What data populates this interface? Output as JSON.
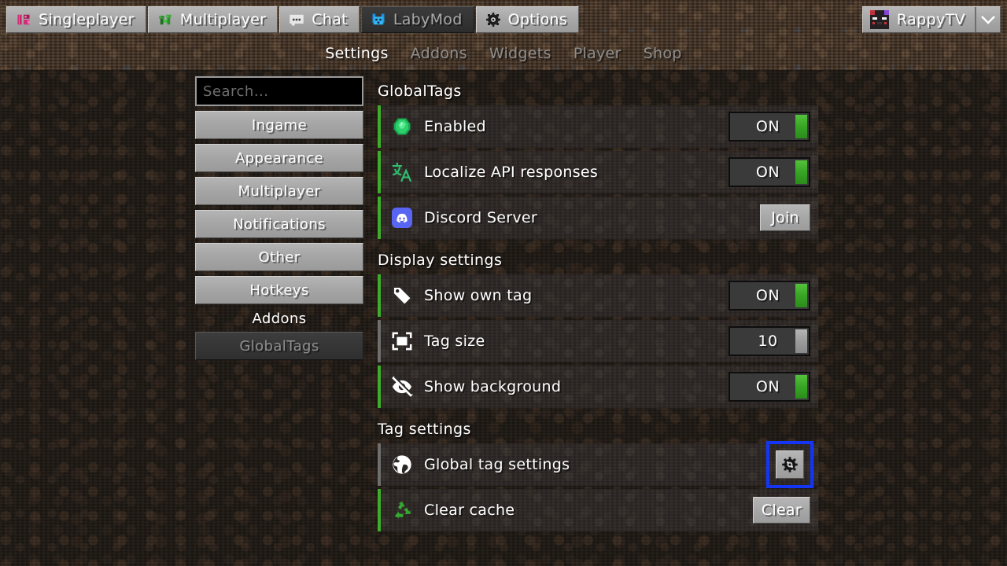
{
  "theme": {
    "accent_green": "#3fad2a",
    "accent_gray": "#6f6f6f",
    "focus_blue": "#1535f5",
    "discord_blurple": "#5865F2",
    "background_dirt": "#1d1712",
    "header_dirt": "#3e2d1f",
    "row_background": "#2c2724",
    "text_white": "#ffffff",
    "text_muted": "#8d8d8d"
  },
  "topnav": {
    "items": [
      {
        "label": "Singleplayer",
        "icon": "singleplayer-icon",
        "active": false
      },
      {
        "label": "Multiplayer",
        "icon": "multiplayer-icon",
        "active": false
      },
      {
        "label": "Chat",
        "icon": "chat-icon",
        "active": false
      },
      {
        "label": "LabyMod",
        "icon": "labymod-icon",
        "active": true
      },
      {
        "label": "Options",
        "icon": "options-gear-icon",
        "active": false
      }
    ],
    "user": {
      "name": "RappyTV",
      "avatar_icon": "player-head-avatar",
      "caret_icon": "chevron-down-icon"
    }
  },
  "subtabs": [
    {
      "label": "Settings",
      "active": true
    },
    {
      "label": "Addons",
      "active": false
    },
    {
      "label": "Widgets",
      "active": false
    },
    {
      "label": "Player",
      "active": false
    },
    {
      "label": "Shop",
      "active": false
    }
  ],
  "sidebar": {
    "search": {
      "placeholder": "Search...",
      "value": ""
    },
    "items": [
      {
        "label": "Ingame",
        "selected": false
      },
      {
        "label": "Appearance",
        "selected": false
      },
      {
        "label": "Multiplayer",
        "selected": false
      },
      {
        "label": "Notifications",
        "selected": false
      },
      {
        "label": "Other",
        "selected": false
      },
      {
        "label": "Hotkeys",
        "selected": false
      }
    ],
    "group_label": "Addons",
    "addons": [
      {
        "label": "GlobalTags",
        "selected": true
      }
    ]
  },
  "main": {
    "sections": [
      {
        "title": "GlobalTags",
        "rows": [
          {
            "label": "Enabled",
            "icon": "emerald-icon",
            "accent": "green",
            "control": {
              "type": "toggle",
              "value": "ON",
              "state": "on"
            }
          },
          {
            "label": "Localize API responses",
            "icon": "translate-icon",
            "accent": "green",
            "control": {
              "type": "toggle",
              "value": "ON",
              "state": "on"
            }
          },
          {
            "label": "Discord Server",
            "icon": "discord-icon",
            "accent": "green",
            "control": {
              "type": "button",
              "value": "Join"
            }
          }
        ]
      },
      {
        "title": "Display settings",
        "rows": [
          {
            "label": "Show own tag",
            "icon": "tag-icon",
            "accent": "green",
            "control": {
              "type": "toggle",
              "value": "ON",
              "state": "on"
            }
          },
          {
            "label": "Tag size",
            "icon": "resize-frame-icon",
            "accent": "gray",
            "control": {
              "type": "slider",
              "value": "10",
              "state": "gray"
            }
          },
          {
            "label": "Show background",
            "icon": "eye-off-icon",
            "accent": "green",
            "control": {
              "type": "toggle",
              "value": "ON",
              "state": "on"
            }
          }
        ]
      },
      {
        "title": "Tag settings",
        "rows": [
          {
            "label": "Global tag settings",
            "icon": "globe-icon",
            "accent": "gray",
            "control": {
              "type": "icon-button",
              "icon": "gear-icon",
              "focused": true
            }
          },
          {
            "label": "Clear cache",
            "icon": "recycle-icon",
            "accent": "green",
            "control": {
              "type": "button",
              "value": "Clear"
            }
          }
        ]
      }
    ]
  }
}
